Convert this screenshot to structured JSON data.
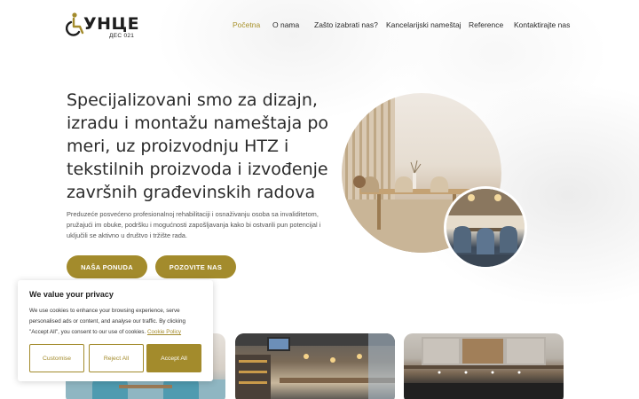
{
  "brand": {
    "name": "УНЦЕ",
    "subtitle": "ДЕС 021",
    "accent_color": "#a38b2c",
    "logo_icon": "wheelchair-icon"
  },
  "nav": {
    "items": [
      {
        "label": "Početna",
        "active": true
      },
      {
        "label": "O nama",
        "active": false
      },
      {
        "label": "Zašto izabrati nas?",
        "active": false
      },
      {
        "label": "Kancelarijski nameštaj",
        "active": false
      },
      {
        "label": "Reference",
        "active": false
      },
      {
        "label": "Kontaktirajte nas",
        "active": false
      }
    ]
  },
  "hero": {
    "title": "Specijalizovani smo za dizajn, izradu i montažu nameštaja po meri, uz proizvodnju HTZ i tekstilnih proizvoda i izvođenje završnih građevinskih radova",
    "description": "Preduzeće posvećeno profesionalnoj rehabilitaciji i osnaživanju osoba sa invaliditetom, pružajući im obuke, podršku i mogućnosti zapošljavanja kako bi ostvarili pun potencijal i uključili se aktivno u društvo i tržište rada.",
    "primary_button": "NAŠA PONUDA",
    "secondary_button": "POZOVITE NAS"
  },
  "cookie": {
    "title": "We value your privacy",
    "text": "We use cookies to enhance your browsing experience, serve personalised ads or content, and analyse our traffic. By clicking \"Accept All\", you consent to our use of cookies.",
    "link": "Cookie Policy",
    "customise": "Customise",
    "reject": "Reject All",
    "accept": "Accept All"
  }
}
